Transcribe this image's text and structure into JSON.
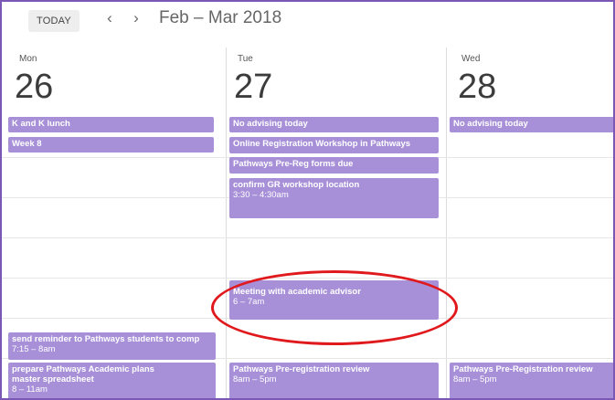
{
  "toolbar": {
    "today_label": "TODAY",
    "prev_icon": "chevron-left-icon",
    "next_icon": "chevron-right-icon",
    "prev_glyph": "‹",
    "next_glyph": "›",
    "date_range": "Feb – Mar 2018"
  },
  "days": [
    {
      "name": "Mon",
      "number": "26"
    },
    {
      "name": "Tue",
      "number": "27"
    },
    {
      "name": "Wed",
      "number": "28"
    }
  ],
  "events": {
    "mon_k_and_k": {
      "title": "K and K lunch"
    },
    "mon_week8": {
      "title": "Week 8"
    },
    "tue_no_advising": {
      "title": "No advising today"
    },
    "tue_online_reg": {
      "title": "Online Registration Workshop in Pathways"
    },
    "tue_prereg_forms": {
      "title": "Pathways Pre-Reg forms due"
    },
    "tue_confirm_gr": {
      "title": "confirm GR workshop location",
      "time": "3:30 – 4:30am"
    },
    "tue_meeting": {
      "title": "Meeting with academic advisor",
      "time": "6 – 7am"
    },
    "mon_send_reminder": {
      "title": "send reminder to Pathways students to comp",
      "time": "7:15 – 8am"
    },
    "mon_prepare": {
      "title": "prepare Pathways Academic plans master spreadsheet",
      "time": "8 – 11am"
    },
    "tue_prereg_review": {
      "title": "Pathways Pre-registration review",
      "time": "8am – 5pm"
    },
    "wed_no_advising": {
      "title": "No advising today"
    },
    "wed_prereg_review": {
      "title": "Pathways Pre-Registration review",
      "time": "8am – 5pm"
    }
  },
  "colors": {
    "event_bg": "#a790d8",
    "annotation_circle": "#e0191c",
    "frame_border": "#7b57b6"
  }
}
